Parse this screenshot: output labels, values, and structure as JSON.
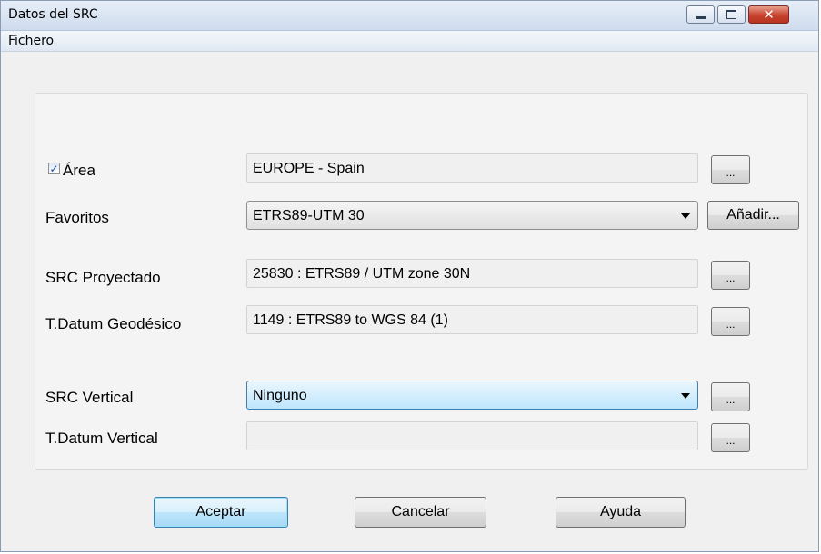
{
  "window": {
    "title": "Datos del SRC",
    "close_glyph": "✕"
  },
  "menu": {
    "items": [
      "Fichero"
    ]
  },
  "form": {
    "area": {
      "checked": true,
      "label": "Área",
      "value": "EUROPE - Spain",
      "browse_label": "..."
    },
    "favoritos": {
      "label": "Favoritos",
      "selected": "ETRS89-UTM 30",
      "add_label": "Añadir..."
    },
    "src_proyectado": {
      "label": "SRC Proyectado",
      "value": "25830 : ETRS89 / UTM zone 30N",
      "browse_label": "..."
    },
    "t_datum_geodesico": {
      "label": "T.Datum Geodésico",
      "value": "1149 : ETRS89 to WGS 84 (1)",
      "browse_label": "..."
    },
    "src_vertical": {
      "label": "SRC Vertical",
      "selected": "Ninguno",
      "browse_label": "..."
    },
    "t_datum_vertical": {
      "label": "T.Datum Vertical",
      "value": "",
      "browse_label": "..."
    }
  },
  "buttons": {
    "accept": "Aceptar",
    "cancel": "Cancelar",
    "help": "Ayuda"
  },
  "colors": {
    "titlebar": "#cfdced",
    "close_button": "#c7412d",
    "default_button_border": "#3c7fb1"
  }
}
